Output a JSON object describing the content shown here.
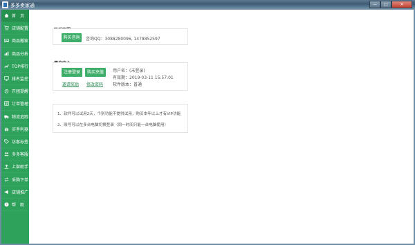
{
  "window": {
    "title": "多多卖家通",
    "min": "—",
    "max": "□",
    "close": "✕"
  },
  "sidebar": {
    "items": [
      {
        "label": "首　页",
        "icon": "home-icon",
        "active": true
      },
      {
        "label": "店铺配置",
        "icon": "cart-icon"
      },
      {
        "label": "商品搬家",
        "icon": "image-icon"
      },
      {
        "label": "商品分析",
        "icon": "chart-icon"
      },
      {
        "label": "TOP排行",
        "icon": "trend-icon"
      },
      {
        "label": "排名监控",
        "icon": "monitor-icon"
      },
      {
        "label": "开团提醒",
        "icon": "alarm-icon"
      },
      {
        "label": "订单管理",
        "icon": "list-icon"
      },
      {
        "label": "物流追踪",
        "icon": "truck-icon"
      },
      {
        "label": "买手利器",
        "icon": "hand-icon"
      },
      {
        "label": "访客标签",
        "icon": "tag-icon"
      },
      {
        "label": "多多客服",
        "icon": "users-icon"
      },
      {
        "label": "上架助手",
        "icon": "upload-icon"
      },
      {
        "label": "采购下单",
        "icon": "purchase-icon"
      },
      {
        "label": "店铺推广",
        "icon": "promote-icon"
      },
      {
        "label": "帮　助",
        "icon": "help-icon"
      }
    ]
  },
  "contact": {
    "title": "联系客服",
    "button": "购买咨询",
    "text": "咨询QQ：3088280096, 1478852597"
  },
  "user_center": {
    "title": "用户中心",
    "register_button": "注册登录",
    "buy_button": "购买充值",
    "invite_link": "邀请奖励",
    "change_pwd_link": "修改密码",
    "username": "用户名：(未登录)",
    "expiry": "有效期：2019-03-11 15:57:01",
    "version": "软件版本：普通"
  },
  "notes": {
    "line1": "1、软件可以试用2天，个别功能不提供试用，购买本年以上才有VIP功能",
    "line2": "2、账号可以在多台电脑切换登录（同一时间只能一台电脑使用）"
  }
}
